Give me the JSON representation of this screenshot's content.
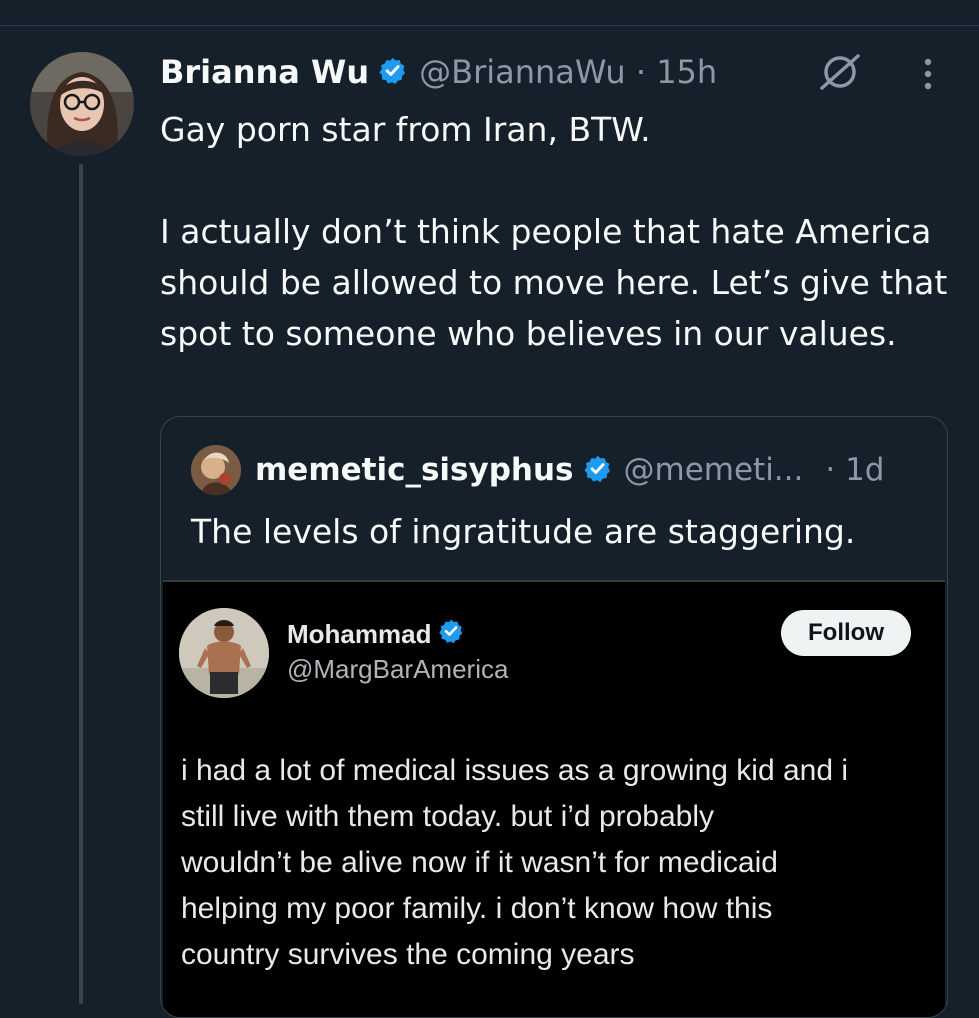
{
  "colors": {
    "background": "#15202b",
    "verified_badge": "#1d9bf0",
    "secondary_text": "#8b98a5"
  },
  "tweet": {
    "author_name": "Brianna Wu",
    "handle_time": "@BriannaWu · 15h",
    "text": "Gay porn star from Iran, BTW.\n\nI actually don’t think people that hate America should be allowed to move here. Let’s give that spot to someone who believes in our values."
  },
  "quote": {
    "author_name": "memetic_sisyphus",
    "handle": "@memeti...",
    "time": "· 1d",
    "text": "The levels of ingratitude are staggering."
  },
  "screenshot": {
    "name": "Mohammad",
    "handle": "@MargBarAmerica",
    "follow_label": "Follow",
    "text": "i had a lot of medical issues as a growing kid and i\nstill live with them today. but i’d probably\nwouldn’t be alive now if it wasn’t for medicaid\nhelping my poor family. i don’t know how this\ncountry survives the coming years"
  }
}
